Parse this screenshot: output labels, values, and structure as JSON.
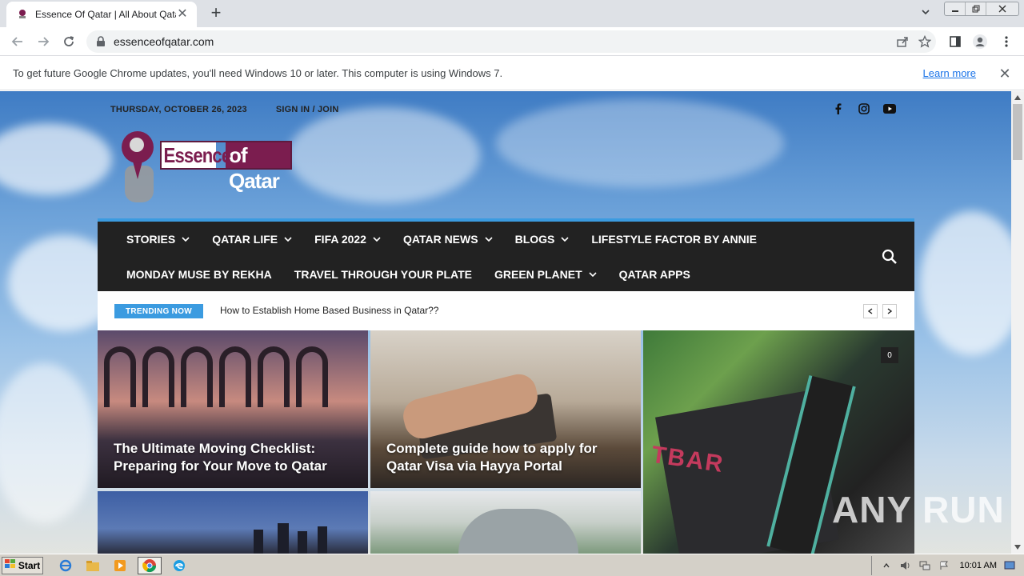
{
  "browser": {
    "tab_title": "Essence Of Qatar | All About Qatar",
    "new_tab_symbol": "+",
    "close_symbol": "✕",
    "url": "essenceofqatar.com"
  },
  "infobar": {
    "message": "To get future Google Chrome updates, you'll need Windows 10 or later. This computer is using Windows 7.",
    "learn_more": "Learn more"
  },
  "site": {
    "date": "THURSDAY, OCTOBER 26, 2023",
    "signin": "SIGN IN / JOIN",
    "logo_word1": "Essence",
    "logo_word2": "of Qatar",
    "nav_row1": [
      "STORIES",
      "QATAR LIFE",
      "FIFA 2022",
      "QATAR NEWS",
      "BLOGS",
      "LIFESTYLE FACTOR BY ANNIE"
    ],
    "nav_row2": [
      "MONDAY MUSE BY REKHA",
      "TRAVEL THROUGH YOUR PLATE",
      "GREEN PLANET",
      "QATAR APPS"
    ],
    "trending_label": "TRENDING NOW",
    "trending_headline": "How to Establish Home Based Business in Qatar??",
    "tiles": [
      {
        "caption": "The Ultimate Moving Checklist: Preparing for Your Move to Qatar"
      },
      {
        "caption": "Complete guide how to apply for Qatar Visa via Hayya Portal"
      },
      {
        "caption": ""
      }
    ],
    "comment_count": "0",
    "tile3_text": "TBAR",
    "watermark": "ANY RUN"
  },
  "taskbar": {
    "start_label": "Start",
    "clock": "10:01 AM"
  }
}
